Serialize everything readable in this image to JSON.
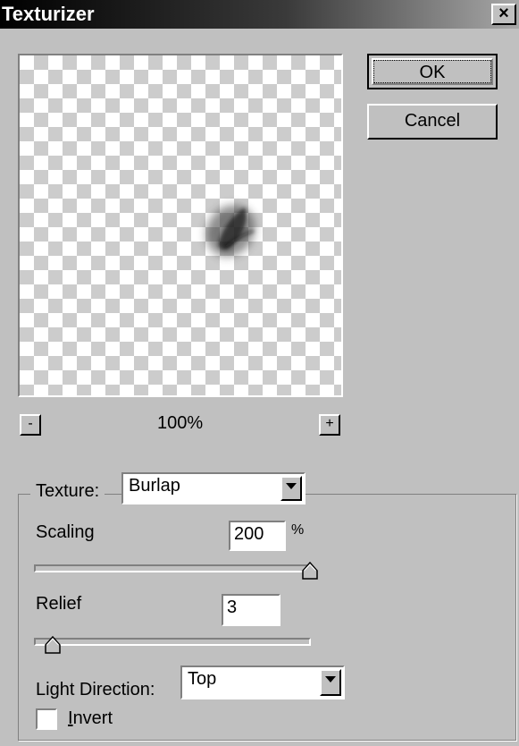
{
  "window": {
    "title": "Texturizer",
    "close_symbol": "×"
  },
  "buttons": {
    "ok": "OK",
    "cancel": "Cancel"
  },
  "zoom": {
    "minus": "-",
    "plus": "+",
    "level": "100%"
  },
  "texture": {
    "label": "Texture:",
    "value": "Burlap"
  },
  "scaling": {
    "label": "Scaling",
    "value": "200",
    "unit": "%",
    "slider_fraction": 1.0
  },
  "relief": {
    "label": "Relief",
    "value": "3",
    "slider_fraction": 0.06
  },
  "light_direction": {
    "label": "Light Direction:",
    "value": "Top"
  },
  "invert": {
    "label_first": "I",
    "label_rest": "nvert",
    "checked": false
  }
}
